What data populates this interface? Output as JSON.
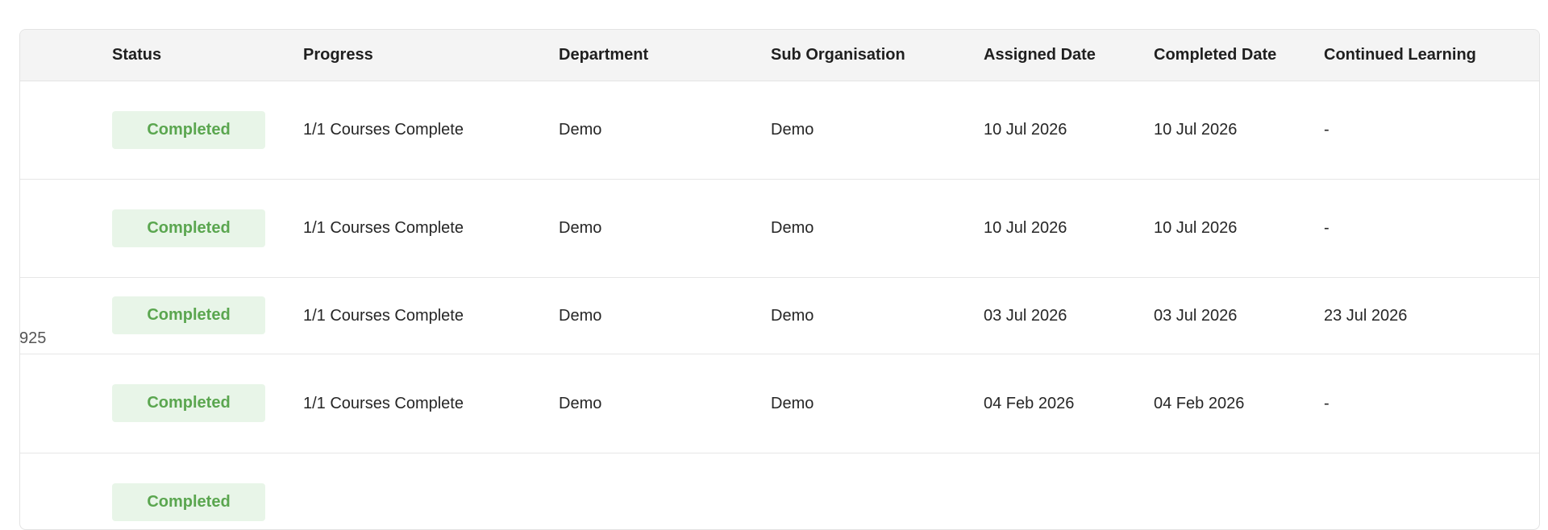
{
  "table": {
    "headers": {
      "status": "Status",
      "progress": "Progress",
      "department": "Department",
      "sub_organisation": "Sub Organisation",
      "assigned_date": "Assigned Date",
      "completed_date": "Completed Date",
      "continued_learning": "Continued Learning"
    },
    "rows": [
      {
        "status": "Completed",
        "progress": "1/1 Courses Complete",
        "department": "Demo",
        "sub_organisation": "Demo",
        "assigned_date": "10 Jul 2026",
        "completed_date": "10 Jul 2026",
        "continued_learning": "-"
      },
      {
        "status": "Completed",
        "progress": "1/1 Courses Complete",
        "department": "Demo",
        "sub_organisation": "Demo",
        "assigned_date": "10 Jul 2026",
        "completed_date": "10 Jul 2026",
        "continued_learning": "-"
      },
      {
        "status": "Completed",
        "progress": "1/1 Courses Complete",
        "department": "Demo",
        "sub_organisation": "Demo",
        "assigned_date": "03 Jul 2026",
        "completed_date": "03 Jul 2026",
        "continued_learning": "23 Jul 2026"
      },
      {
        "status": "Completed",
        "progress": "1/1 Courses Complete",
        "department": "Demo",
        "sub_organisation": "Demo",
        "assigned_date": "04 Feb 2026",
        "completed_date": "04 Feb 2026",
        "continued_learning": "-"
      },
      {
        "status": "Completed",
        "progress": "",
        "department": "",
        "sub_organisation": "",
        "assigned_date": "",
        "completed_date": "",
        "continued_learning": ""
      }
    ],
    "stray_text": "925"
  },
  "colors": {
    "badge_bg": "#e8f5e8",
    "badge_text": "#5aa64f",
    "header_bg": "#f4f4f4"
  }
}
